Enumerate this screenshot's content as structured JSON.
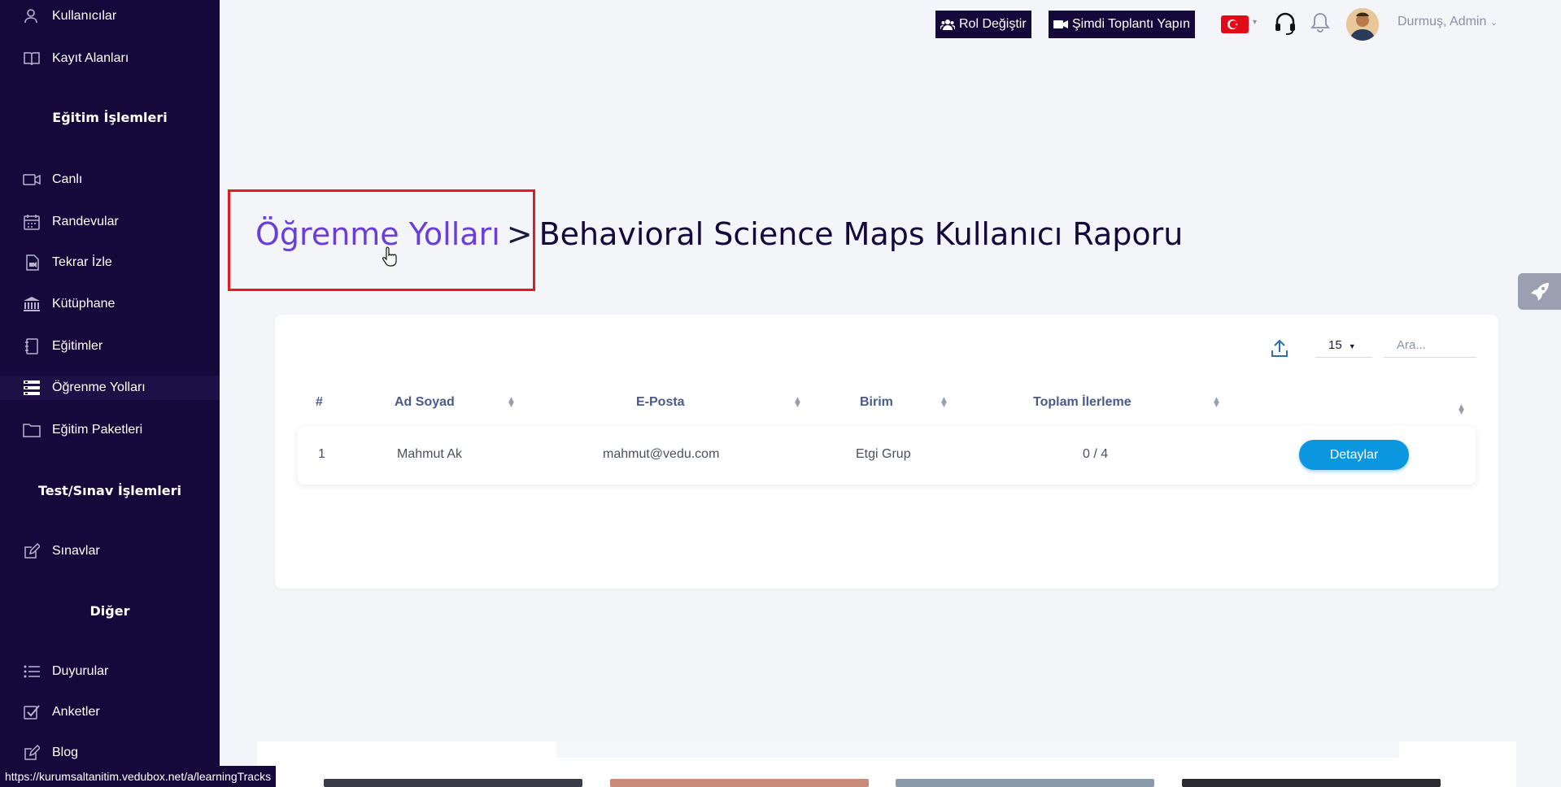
{
  "sidebar": {
    "items_top": [
      {
        "label": "Kullanıcılar",
        "icon": "users-icon"
      },
      {
        "label": "Kayıt Alanları",
        "icon": "book-icon"
      }
    ],
    "section_education": "Eğitim İşlemleri",
    "items_education": [
      {
        "label": "Canlı",
        "icon": "video-icon"
      },
      {
        "label": "Randevular",
        "icon": "calendar-icon"
      },
      {
        "label": "Tekrar İzle",
        "icon": "replay-icon"
      },
      {
        "label": "Kütüphane",
        "icon": "library-icon"
      },
      {
        "label": "Eğitimler",
        "icon": "notebook-icon"
      },
      {
        "label": "Öğrenme Yolları",
        "icon": "tracks-icon"
      },
      {
        "label": "Eğitim Paketleri",
        "icon": "folder-icon"
      }
    ],
    "section_exam": "Test/Sınav İşlemleri",
    "items_exam": [
      {
        "label": "Sınavlar",
        "icon": "edit-icon"
      }
    ],
    "section_other": "Diğer",
    "items_other": [
      {
        "label": "Duyurular",
        "icon": "list-icon"
      },
      {
        "label": "Anketler",
        "icon": "checkbox-icon"
      },
      {
        "label": "Blog",
        "icon": "edit-icon"
      }
    ],
    "active": "Öğrenme Yolları"
  },
  "topbar": {
    "switch_role": "Rol Değiştir",
    "meet_now": "Şimdi Toplantı Yapın",
    "user_name": "Durmuş, Admin"
  },
  "header": {
    "crumb_link": "Öğrenme Yolları",
    "crumb_sep": ">",
    "crumb_current": "Behavioral Science Maps Kullanıcı Raporu"
  },
  "table": {
    "page_size": "15",
    "search_placeholder": "Ara...",
    "columns": [
      "#",
      "Ad Soyad",
      "E-Posta",
      "Birim",
      "Toplam İlerleme"
    ],
    "rows": [
      {
        "no": "1",
        "name": "Mahmut Ak",
        "email": "mahmut@vedu.com",
        "unit": "Etgi Grup",
        "progress": "0 / 4",
        "action": "Detaylar"
      }
    ]
  },
  "status_bar": {
    "url": "https://kurumsaltanitim.vedubox.net/a/learningTracks"
  },
  "colors": {
    "sidebar_bg": "#15093c",
    "link": "#6a3fd8",
    "primary_button": "#0b97e0",
    "highlight": "#e11b22"
  }
}
